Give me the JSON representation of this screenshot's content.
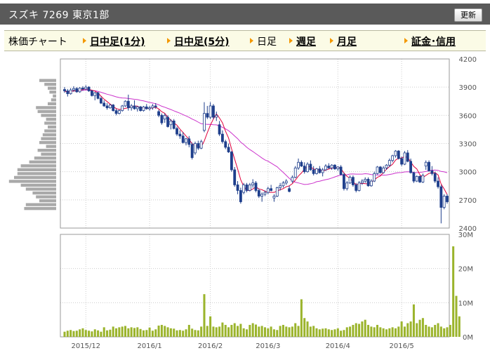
{
  "header": {
    "title": "スズキ 7269 東京1部",
    "refresh_label": "更新"
  },
  "nav": {
    "chart_label": "株価チャート",
    "items": [
      {
        "label": "日中足(1分)",
        "link": true
      },
      {
        "label": "日中足(5分)",
        "link": true
      },
      {
        "label": "日足",
        "link": false
      },
      {
        "label": "週足",
        "link": true
      },
      {
        "label": "月足",
        "link": true
      },
      {
        "label": "証金･信用",
        "link": true
      }
    ]
  },
  "colors": {
    "up_candle": "#ffffff",
    "down_candle": "#1f3f8c",
    "short_ma": "#e0003c",
    "long_ma": "#cc33cc",
    "volume_bar": "#9bb42c",
    "price_profile": "#a9a9a9",
    "grid": "#cccccc"
  },
  "chart_data": {
    "type": "candlestick",
    "price_axis": {
      "ticks": [
        4200,
        3900,
        3600,
        3300,
        3000,
        2700,
        2400
      ],
      "range": [
        2400,
        4200
      ]
    },
    "volume_axis": {
      "ticks": [
        "30M",
        "20M",
        "10M",
        "0M"
      ],
      "range": [
        0,
        30000000
      ]
    },
    "x_labels": [
      "2015/12",
      "2016/1",
      "2016/2",
      "2016/3",
      "2016/4",
      "2016/5"
    ],
    "candles": [
      {
        "o": 3875,
        "h": 3900,
        "l": 3840,
        "c": 3860
      },
      {
        "o": 3860,
        "h": 3880,
        "l": 3800,
        "c": 3830
      },
      {
        "o": 3830,
        "h": 3890,
        "l": 3820,
        "c": 3870
      },
      {
        "o": 3870,
        "h": 3910,
        "l": 3850,
        "c": 3885
      },
      {
        "o": 3885,
        "h": 3900,
        "l": 3840,
        "c": 3850
      },
      {
        "o": 3850,
        "h": 3900,
        "l": 3840,
        "c": 3890
      },
      {
        "o": 3890,
        "h": 3910,
        "l": 3860,
        "c": 3880
      },
      {
        "o": 3880,
        "h": 3920,
        "l": 3870,
        "c": 3900
      },
      {
        "o": 3900,
        "h": 3910,
        "l": 3850,
        "c": 3860
      },
      {
        "o": 3860,
        "h": 3870,
        "l": 3800,
        "c": 3810
      },
      {
        "o": 3810,
        "h": 3850,
        "l": 3760,
        "c": 3840
      },
      {
        "o": 3840,
        "h": 3850,
        "l": 3770,
        "c": 3780
      },
      {
        "o": 3780,
        "h": 3800,
        "l": 3720,
        "c": 3730
      },
      {
        "o": 3730,
        "h": 3760,
        "l": 3690,
        "c": 3700
      },
      {
        "o": 3700,
        "h": 3730,
        "l": 3660,
        "c": 3680
      },
      {
        "o": 3680,
        "h": 3720,
        "l": 3670,
        "c": 3710
      },
      {
        "o": 3710,
        "h": 3720,
        "l": 3640,
        "c": 3650
      },
      {
        "o": 3650,
        "h": 3670,
        "l": 3600,
        "c": 3620
      },
      {
        "o": 3620,
        "h": 3660,
        "l": 3610,
        "c": 3650
      },
      {
        "o": 3650,
        "h": 3710,
        "l": 3640,
        "c": 3700
      },
      {
        "o": 3700,
        "h": 3760,
        "l": 3690,
        "c": 3750
      },
      {
        "o": 3750,
        "h": 3820,
        "l": 3650,
        "c": 3680
      },
      {
        "o": 3680,
        "h": 3720,
        "l": 3650,
        "c": 3700
      },
      {
        "o": 3700,
        "h": 3760,
        "l": 3660,
        "c": 3670
      },
      {
        "o": 3670,
        "h": 3700,
        "l": 3640,
        "c": 3690
      },
      {
        "o": 3690,
        "h": 3700,
        "l": 3640,
        "c": 3650
      },
      {
        "o": 3650,
        "h": 3700,
        "l": 3640,
        "c": 3690
      },
      {
        "o": 3690,
        "h": 3720,
        "l": 3660,
        "c": 3670
      },
      {
        "o": 3670,
        "h": 3700,
        "l": 3650,
        "c": 3680
      },
      {
        "o": 3680,
        "h": 3720,
        "l": 3660,
        "c": 3700
      },
      {
        "o": 3700,
        "h": 3730,
        "l": 3670,
        "c": 3690
      },
      {
        "o": 3640,
        "h": 3660,
        "l": 3580,
        "c": 3600
      },
      {
        "o": 3600,
        "h": 3620,
        "l": 3500,
        "c": 3520
      },
      {
        "o": 3560,
        "h": 3620,
        "l": 3520,
        "c": 3600
      },
      {
        "o": 3580,
        "h": 3600,
        "l": 3470,
        "c": 3480
      },
      {
        "o": 3500,
        "h": 3560,
        "l": 3450,
        "c": 3540
      },
      {
        "o": 3540,
        "h": 3560,
        "l": 3450,
        "c": 3460
      },
      {
        "o": 3460,
        "h": 3480,
        "l": 3380,
        "c": 3400
      },
      {
        "o": 3400,
        "h": 3440,
        "l": 3350,
        "c": 3380
      },
      {
        "o": 3380,
        "h": 3420,
        "l": 3300,
        "c": 3310
      },
      {
        "o": 3310,
        "h": 3360,
        "l": 3280,
        "c": 3350
      },
      {
        "o": 3350,
        "h": 3380,
        "l": 3260,
        "c": 3290
      },
      {
        "o": 3290,
        "h": 3310,
        "l": 3130,
        "c": 3150
      },
      {
        "o": 3200,
        "h": 3320,
        "l": 3180,
        "c": 3300
      },
      {
        "o": 3300,
        "h": 3330,
        "l": 3230,
        "c": 3250
      },
      {
        "o": 3250,
        "h": 3340,
        "l": 3240,
        "c": 3320
      },
      {
        "o": 3440,
        "h": 3740,
        "l": 3420,
        "c": 3620
      },
      {
        "o": 3620,
        "h": 3700,
        "l": 3560,
        "c": 3580
      },
      {
        "o": 3580,
        "h": 3740,
        "l": 3560,
        "c": 3700
      },
      {
        "o": 3700,
        "h": 3720,
        "l": 3560,
        "c": 3580
      },
      {
        "o": 3580,
        "h": 3640,
        "l": 3540,
        "c": 3600
      },
      {
        "o": 3500,
        "h": 3540,
        "l": 3380,
        "c": 3400
      },
      {
        "o": 3400,
        "h": 3440,
        "l": 3300,
        "c": 3320
      },
      {
        "o": 3320,
        "h": 3340,
        "l": 3240,
        "c": 3260
      },
      {
        "o": 3260,
        "h": 3300,
        "l": 3200,
        "c": 3210
      },
      {
        "o": 3210,
        "h": 3220,
        "l": 3000,
        "c": 3020
      },
      {
        "o": 3020,
        "h": 3050,
        "l": 2840,
        "c": 2860
      },
      {
        "o": 2860,
        "h": 2900,
        "l": 2760,
        "c": 2800
      },
      {
        "o": 2800,
        "h": 2830,
        "l": 2660,
        "c": 2680
      },
      {
        "o": 2780,
        "h": 2880,
        "l": 2760,
        "c": 2860
      },
      {
        "o": 2860,
        "h": 2880,
        "l": 2780,
        "c": 2800
      },
      {
        "o": 2800,
        "h": 2880,
        "l": 2790,
        "c": 2860
      },
      {
        "o": 2860,
        "h": 2920,
        "l": 2830,
        "c": 2880
      },
      {
        "o": 2880,
        "h": 2900,
        "l": 2780,
        "c": 2800
      },
      {
        "o": 2800,
        "h": 2820,
        "l": 2720,
        "c": 2740
      },
      {
        "o": 2740,
        "h": 2780,
        "l": 2680,
        "c": 2760
      },
      {
        "o": 2760,
        "h": 2800,
        "l": 2740,
        "c": 2780
      },
      {
        "o": 2780,
        "h": 2840,
        "l": 2760,
        "c": 2820
      },
      {
        "o": 2820,
        "h": 2860,
        "l": 2790,
        "c": 2800
      },
      {
        "o": 2720,
        "h": 2760,
        "l": 2680,
        "c": 2740
      },
      {
        "o": 2740,
        "h": 2840,
        "l": 2730,
        "c": 2830
      },
      {
        "o": 2830,
        "h": 2880,
        "l": 2800,
        "c": 2850
      },
      {
        "o": 2850,
        "h": 2900,
        "l": 2830,
        "c": 2880
      },
      {
        "o": 2880,
        "h": 2920,
        "l": 2860,
        "c": 2900
      },
      {
        "o": 2820,
        "h": 2850,
        "l": 2780,
        "c": 2790
      },
      {
        "o": 2900,
        "h": 2960,
        "l": 2880,
        "c": 2940
      },
      {
        "o": 2940,
        "h": 3060,
        "l": 2930,
        "c": 3040
      },
      {
        "o": 3040,
        "h": 3140,
        "l": 3020,
        "c": 3100
      },
      {
        "o": 3100,
        "h": 3120,
        "l": 3050,
        "c": 3060
      },
      {
        "o": 3060,
        "h": 3100,
        "l": 2980,
        "c": 3000
      },
      {
        "o": 3000,
        "h": 3100,
        "l": 2990,
        "c": 3080
      },
      {
        "o": 3080,
        "h": 3120,
        "l": 3010,
        "c": 3020
      },
      {
        "o": 3020,
        "h": 3060,
        "l": 2960,
        "c": 2980
      },
      {
        "o": 2980,
        "h": 3040,
        "l": 2970,
        "c": 3030
      },
      {
        "o": 3030,
        "h": 3060,
        "l": 2980,
        "c": 2990
      },
      {
        "o": 2990,
        "h": 3040,
        "l": 2950,
        "c": 3020
      },
      {
        "o": 3020,
        "h": 3080,
        "l": 3010,
        "c": 3060
      },
      {
        "o": 3060,
        "h": 3090,
        "l": 3030,
        "c": 3040
      },
      {
        "o": 3040,
        "h": 3080,
        "l": 3020,
        "c": 3070
      },
      {
        "o": 3070,
        "h": 3080,
        "l": 3020,
        "c": 3030
      },
      {
        "o": 3030,
        "h": 3060,
        "l": 3010,
        "c": 3050
      },
      {
        "o": 3050,
        "h": 3070,
        "l": 2960,
        "c": 2970
      },
      {
        "o": 2970,
        "h": 2990,
        "l": 2800,
        "c": 2820
      },
      {
        "o": 2820,
        "h": 2900,
        "l": 2800,
        "c": 2880
      },
      {
        "o": 2880,
        "h": 2960,
        "l": 2870,
        "c": 2940
      },
      {
        "o": 2940,
        "h": 2960,
        "l": 2840,
        "c": 2860
      },
      {
        "o": 2860,
        "h": 2880,
        "l": 2780,
        "c": 2800
      },
      {
        "o": 2800,
        "h": 2900,
        "l": 2790,
        "c": 2880
      },
      {
        "o": 2880,
        "h": 2920,
        "l": 2860,
        "c": 2900
      },
      {
        "o": 2900,
        "h": 2940,
        "l": 2880,
        "c": 2920
      },
      {
        "o": 2920,
        "h": 2940,
        "l": 2840,
        "c": 2850
      },
      {
        "o": 2850,
        "h": 2920,
        "l": 2840,
        "c": 2900
      },
      {
        "o": 2900,
        "h": 3000,
        "l": 2890,
        "c": 2980
      },
      {
        "o": 2980,
        "h": 3060,
        "l": 2970,
        "c": 3050
      },
      {
        "o": 3050,
        "h": 3060,
        "l": 2980,
        "c": 2990
      },
      {
        "o": 2990,
        "h": 3060,
        "l": 2980,
        "c": 3040
      },
      {
        "o": 3040,
        "h": 3080,
        "l": 3020,
        "c": 3070
      },
      {
        "o": 3070,
        "h": 3140,
        "l": 3050,
        "c": 3120
      },
      {
        "o": 3120,
        "h": 3180,
        "l": 3100,
        "c": 3170
      },
      {
        "o": 3170,
        "h": 3230,
        "l": 3150,
        "c": 3220
      },
      {
        "o": 3220,
        "h": 3230,
        "l": 3130,
        "c": 3140
      },
      {
        "o": 3140,
        "h": 3160,
        "l": 3060,
        "c": 3080
      },
      {
        "o": 3080,
        "h": 3220,
        "l": 3070,
        "c": 3200
      },
      {
        "o": 3200,
        "h": 3230,
        "l": 3100,
        "c": 3110
      },
      {
        "o": 3110,
        "h": 3140,
        "l": 2980,
        "c": 2990
      },
      {
        "o": 2990,
        "h": 3000,
        "l": 2880,
        "c": 2900
      },
      {
        "o": 2900,
        "h": 2960,
        "l": 2890,
        "c": 2950
      },
      {
        "o": 2950,
        "h": 2960,
        "l": 2880,
        "c": 2890
      },
      {
        "o": 2890,
        "h": 2980,
        "l": 2880,
        "c": 2960
      },
      {
        "o": 3060,
        "h": 3120,
        "l": 3020,
        "c": 3100
      },
      {
        "o": 3100,
        "h": 3120,
        "l": 3000,
        "c": 3010
      },
      {
        "o": 3010,
        "h": 3060,
        "l": 2960,
        "c": 2980
      },
      {
        "o": 2980,
        "h": 3000,
        "l": 2880,
        "c": 2900
      },
      {
        "o": 2900,
        "h": 2940,
        "l": 2820,
        "c": 2840
      },
      {
        "o": 2840,
        "h": 2860,
        "l": 2450,
        "c": 2620
      },
      {
        "o": 2620,
        "h": 2760,
        "l": 2600,
        "c": 2740
      },
      {
        "o": 2740,
        "h": 2760,
        "l": 2660,
        "c": 2680
      }
    ],
    "volume_millions": [
      1.5,
      1.8,
      2.0,
      1.7,
      1.8,
      2.2,
      2.5,
      2.0,
      1.8,
      1.6,
      2.2,
      1.9,
      1.5,
      2.8,
      1.9,
      2.1,
      3.0,
      2.5,
      2.8,
      3.0,
      3.2,
      2.5,
      2.8,
      2.6,
      2.8,
      2.3,
      1.9,
      2.0,
      2.7,
      1.8,
      2.2,
      3.3,
      3.5,
      3.2,
      2.8,
      2.5,
      2.4,
      1.9,
      2.0,
      1.8,
      2.2,
      3.5,
      2.4,
      2.0,
      1.9,
      3.0,
      12.5,
      3.2,
      6.0,
      3.0,
      2.8,
      3.0,
      4.2,
      3.5,
      2.8,
      3.5,
      4.0,
      3.2,
      3.8,
      2.5,
      2.2,
      3.5,
      4.0,
      3.6,
      3.0,
      3.2,
      2.8,
      2.5,
      3.0,
      2.2,
      2.0,
      3.2,
      3.5,
      3.0,
      2.8,
      3.0,
      4.0,
      3.2,
      11.0,
      5.5,
      4.5,
      3.0,
      3.2,
      2.5,
      2.2,
      2.4,
      2.5,
      2.2,
      2.0,
      2.2,
      2.5,
      1.8,
      2.0,
      2.8,
      3.0,
      3.5,
      4.0,
      3.8,
      4.5,
      5.0,
      3.5,
      3.0,
      2.8,
      3.5,
      2.8,
      2.5,
      2.2,
      2.5,
      2.8,
      2.5,
      3.0,
      4.5,
      3.0,
      4.0,
      4.5,
      9.5,
      4.0,
      5.0,
      5.5,
      3.5,
      3.0,
      2.8,
      3.5,
      4.0,
      3.0,
      2.5,
      2.8,
      3.5,
      26.5,
      12.0,
      6.0
    ],
    "price_profile": [
      20,
      14,
      10,
      8,
      4,
      6,
      10,
      24,
      22,
      18,
      12,
      14,
      10,
      14,
      16,
      18,
      20,
      12,
      22,
      18,
      26,
      32,
      42,
      46,
      46,
      50,
      56,
      42,
      36,
      28,
      24,
      20,
      36,
      38
    ]
  }
}
